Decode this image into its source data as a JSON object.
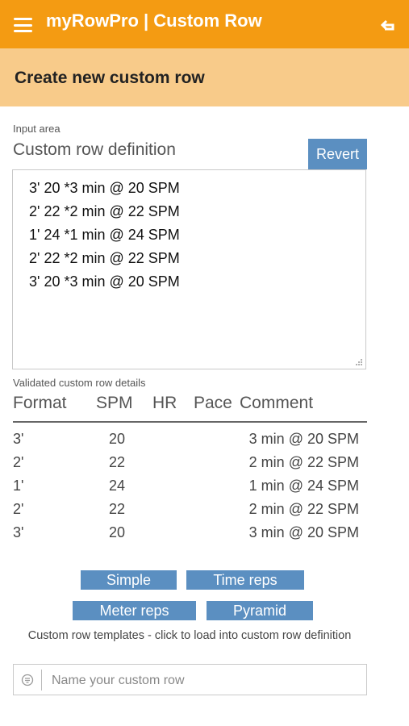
{
  "appbar": {
    "title": "myRowPro | Custom Row",
    "menu_icon": "hamburger-menu-icon",
    "back_icon": "return-arrow-icon",
    "color": "#f49b12"
  },
  "subheader": {
    "title": "Create new custom row",
    "color": "#f8cb8a"
  },
  "input_area": {
    "label": "Input area",
    "title": "Custom row definition",
    "revert_label": "Revert",
    "lines": [
      "3' 20 *3 min @ 20 SPM",
      "2' 22 *2 min @ 22 SPM",
      "1' 24 *1 min @ 24 SPM",
      "2' 22 *2 min @ 22 SPM",
      "3' 20 *3 min @ 20 SPM"
    ]
  },
  "validated": {
    "label": "Validated custom row details",
    "columns": [
      "Format",
      "SPM",
      "HR",
      "Pace",
      "Comment"
    ],
    "rows": [
      {
        "format": "3'",
        "spm": "20",
        "hr": "",
        "pace": "",
        "comment": "3 min @ 20 SPM"
      },
      {
        "format": "2'",
        "spm": "22",
        "hr": "",
        "pace": "",
        "comment": "2 min @ 22 SPM"
      },
      {
        "format": "1'",
        "spm": "24",
        "hr": "",
        "pace": "",
        "comment": "1 min @ 24 SPM"
      },
      {
        "format": "2'",
        "spm": "22",
        "hr": "",
        "pace": "",
        "comment": "2 min @ 22 SPM"
      },
      {
        "format": "3'",
        "spm": "20",
        "hr": "",
        "pace": "",
        "comment": "3 min @ 20 SPM"
      }
    ]
  },
  "templates": {
    "buttons": [
      "Simple",
      "Time reps",
      "Meter reps",
      "Pyramid"
    ],
    "caption": "Custom row templates - click to load into custom row definition",
    "button_color": "#5b8fc1"
  },
  "name_field": {
    "placeholder": "Name your custom row",
    "value": "",
    "icon": "name-tag-icon"
  }
}
